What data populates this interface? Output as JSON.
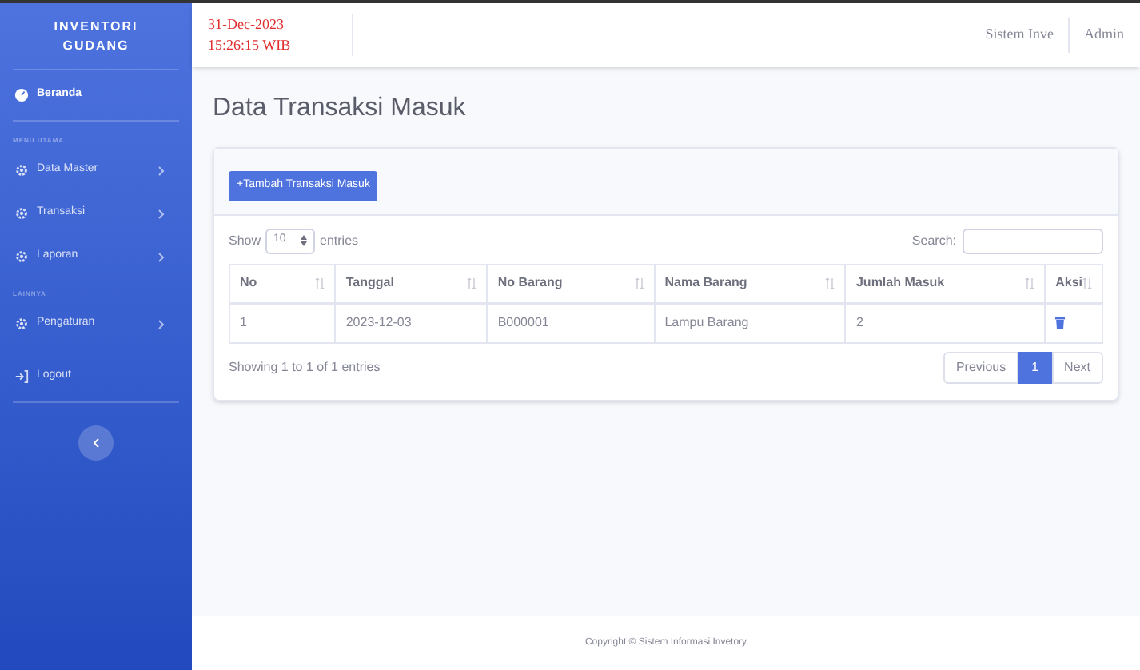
{
  "sidebar": {
    "brand": "INVENTORI GUDANG",
    "items": [
      {
        "kind": "home",
        "label": "Beranda",
        "selected": true
      },
      {
        "kind": "heading",
        "label": "MENU UTAMA"
      },
      {
        "kind": "menu",
        "label": "Data Master",
        "selected": false
      },
      {
        "kind": "menu",
        "label": "Transaksi",
        "selected": false
      },
      {
        "kind": "menu",
        "label": "Laporan",
        "selected": false
      },
      {
        "kind": "heading",
        "label": "LAINNYA"
      },
      {
        "kind": "menu",
        "label": "Pengaturan",
        "selected": false
      },
      {
        "kind": "logout",
        "label": "Logout",
        "selected": false
      }
    ]
  },
  "topbar": {
    "date": "31-Dec-2023",
    "time": "15:26:15 WIB",
    "links": [
      "Sistem Inve",
      "Admin"
    ]
  },
  "page_title": "Data Transaksi Masuk",
  "card": {
    "add_button": "+Tambah Transaksi Masuk",
    "show_label": "Show",
    "page_size": "10",
    "entries_label": "entries",
    "search_label": "Search:",
    "table": {
      "columns": [
        "No",
        "Tanggal",
        "No Barang",
        "Nama Barang",
        "Jumlah Masuk",
        "Aksi"
      ],
      "rows": [
        {
          "cells": [
            "1",
            "2023-12-03",
            "B000001",
            "Lampu Barang",
            "2"
          ]
        }
      ]
    },
    "info": "Showing 1 to 1 of 1 entries",
    "pagination": [
      {
        "label": "Previous",
        "selected": false
      },
      {
        "label": "1",
        "selected": true
      },
      {
        "label": "Next",
        "selected": false
      }
    ]
  },
  "footer": "Copyright © Sistem Informasi Invetory"
}
